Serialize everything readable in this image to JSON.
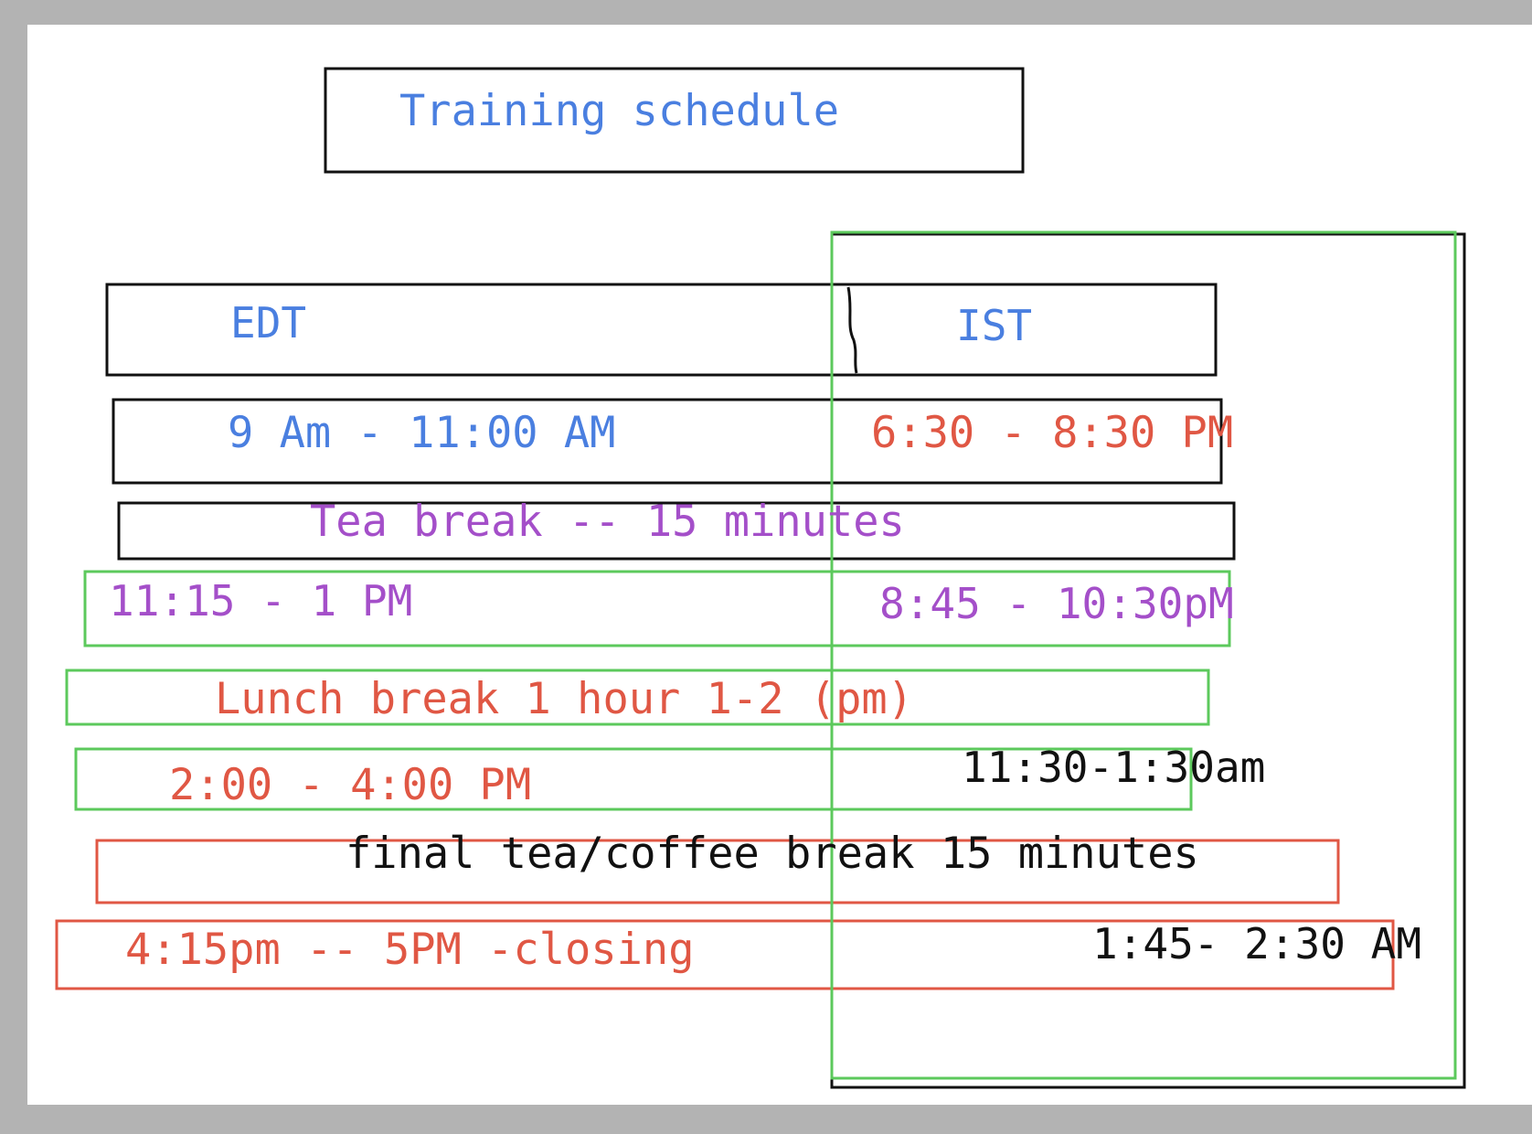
{
  "colors": {
    "blue": "#4a7fe0",
    "red": "#e05744",
    "purple": "#a44fc9",
    "black": "#111111",
    "green": "#5cc95c",
    "outline": "#111111"
  },
  "title": "Training schedule",
  "headers": {
    "edt": "EDT",
    "ist": "IST"
  },
  "rows": [
    {
      "edt": "9 Am - 11:00 AM",
      "ist": "6:30 - 8:30 PM"
    },
    {
      "break": "Tea break -- 15 minutes"
    },
    {
      "edt": "11:15 - 1 PM",
      "ist": "8:45 - 10:30pM"
    },
    {
      "break": "Lunch break 1 hour 1-2 (pm)"
    },
    {
      "edt": "2:00 - 4:00 PM",
      "ist": "11:30-1:30am"
    },
    {
      "break": "final tea/coffee break 15 minutes"
    },
    {
      "edt": "4:15pm -- 5PM -closing",
      "ist": "1:45- 2:30 AM"
    }
  ]
}
